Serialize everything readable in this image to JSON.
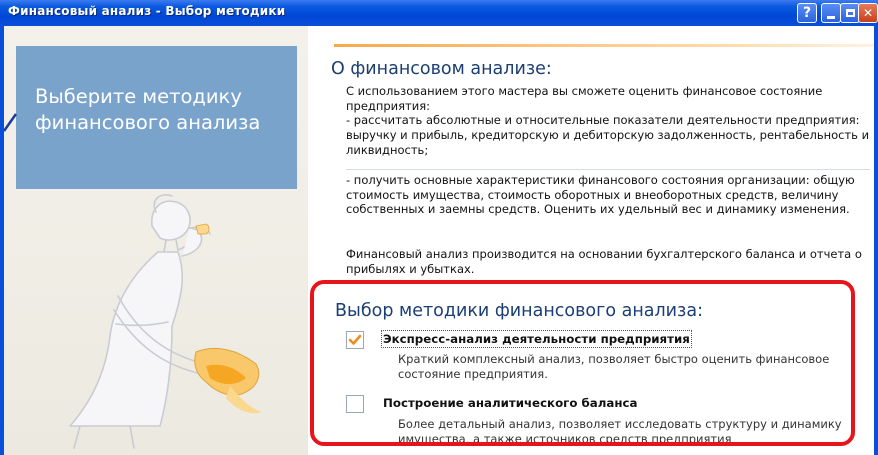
{
  "window": {
    "title": "Финансовый анализ - Выбор методики",
    "help_label": "?",
    "close_label": "✕"
  },
  "left_panel": {
    "heading_line1": "Выберите методику",
    "heading_line2": "финансового анализа"
  },
  "about": {
    "title": "О финансовом анализе:",
    "intro": "С использованием этого мастера вы сможете оценить финансовое состояние предприятия:",
    "bullet1": "- рассчитать абсолютные и относительные показатели деятельности предприятия: выручку и прибыль, кредиторскую и дебиторскую задолженность, рентабельность и ликвидность;",
    "bullet2": "- получить основные характеристики финансового состояния организации: общую стоимость имущества, стоимость оборотных и внеоборотных средств, величину собственных и заемны средств. Оценить их удельный вес и динамику изменения.",
    "basis": "Финансовый анализ производится на основании бухгалтерского баланса и отчета о прибылях и убытках."
  },
  "methods": {
    "title": "Выбор методики финансового анализа:",
    "options": [
      {
        "label": "Экспресс-анализ деятельности предприятия",
        "description": "Краткий комплексный анализ, позволяет быстро оценить финансовое состояние предприятия.",
        "checked": true
      },
      {
        "label": "Построение аналитического баланса",
        "description": "Более детальный анализ, позволяет исследовать структуру и динамику имущества, а также источников средств предприятия",
        "checked": false
      }
    ]
  },
  "colors": {
    "accent_orange": "#f7a94a",
    "highlight_red": "#e8141b",
    "heading_blue": "#1b3f74",
    "panel_blue": "#7aa3cc"
  },
  "icons": [
    "help-icon",
    "minimize-icon",
    "maximize-icon",
    "close-icon",
    "checkmark-icon"
  ]
}
